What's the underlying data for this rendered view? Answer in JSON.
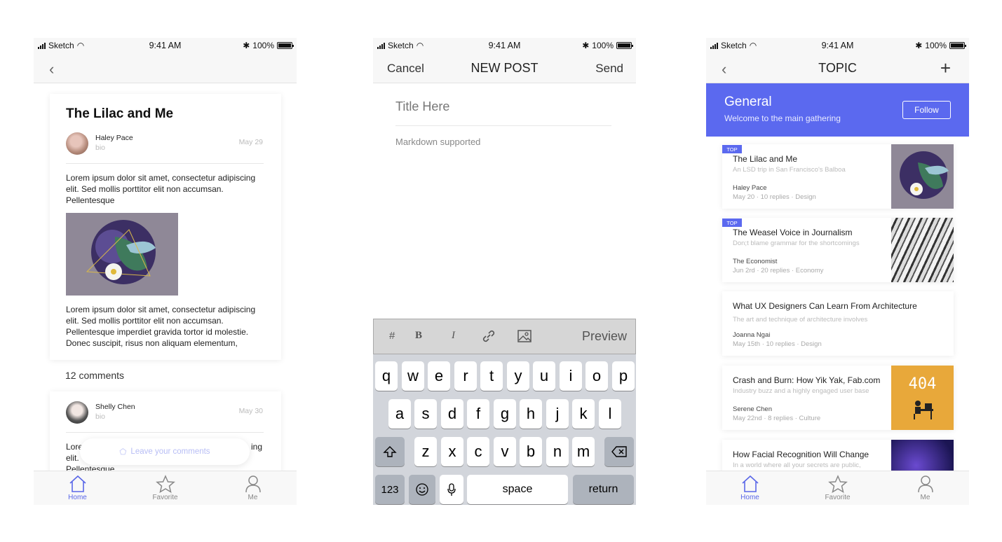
{
  "status": {
    "carrier": "Sketch",
    "time": "9:41 AM",
    "battery": "100%"
  },
  "tabs": [
    {
      "label": "Home",
      "icon": "home-icon"
    },
    {
      "label": "Favorite",
      "icon": "star-icon"
    },
    {
      "label": "Me",
      "icon": "person-icon"
    }
  ],
  "article": {
    "title": "The Lilac and Me",
    "author": "Haley Pace",
    "bio": "bio",
    "date": "May 29",
    "para1": "Lorem ipsum dolor sit amet, consectetur adipiscing elit. Sed mollis porttitor elit non accumsan. Pellentesque",
    "para2": "Lorem ipsum dolor sit amet, consectetur adipiscing elit. Sed mollis porttitor elit non accumsan. Pellentesque imperdiet gravida tortor id molestie. Donec suscipit, risus non aliquam elementum,",
    "comments_count": "12 comments",
    "comment": {
      "author": "Shelly Chen",
      "bio": "bio",
      "date": "May 30",
      "text_start": "Lore",
      "text_line2": "elit.",
      "text_line3": "Pellentesque",
      "text_end": "ing"
    },
    "leave_placeholder": "Leave your comments"
  },
  "new_post": {
    "cancel": "Cancel",
    "title": "NEW POST",
    "send": "Send",
    "title_placeholder": "Title Here",
    "body_placeholder": "Markdown supported",
    "toolbar": {
      "heading": "#",
      "bold": "B",
      "italic": "I",
      "preview": "Preview"
    },
    "keyboard": {
      "row1": [
        "q",
        "w",
        "e",
        "r",
        "t",
        "y",
        "u",
        "i",
        "o",
        "p"
      ],
      "row2": [
        "a",
        "s",
        "d",
        "f",
        "g",
        "h",
        "j",
        "k",
        "l"
      ],
      "row3": [
        "z",
        "x",
        "c",
        "v",
        "b",
        "n",
        "m"
      ],
      "numbers": "123",
      "space": "space",
      "return": "return"
    }
  },
  "topic": {
    "nav_title": "TOPIC",
    "name": "General",
    "subtitle": "Welcome to the main gathering",
    "follow": "Follow",
    "top_badge": "TOP",
    "posts": [
      {
        "title": "The Lilac and Me",
        "sub": "An LSD trip in San Francisco's Balboa",
        "author": "Haley Pace",
        "meta": "May 20 · 10 replies · Design",
        "top": true
      },
      {
        "title": "The Weasel Voice in Journalism",
        "sub": "Don;t blame grammar for the shortcomings",
        "author": "The Economist",
        "meta": "Jun 2rd · 20 replies · Economy",
        "top": true
      },
      {
        "title": "What UX Designers Can Learn From Architecture",
        "sub": "The art and technique of architecture involves",
        "author": "Joanna Ngai",
        "meta": "May 15th · 10 replies · Design",
        "top": false
      },
      {
        "title": "Crash and Burn: How Yik Yak, Fab.com",
        "sub": "Industry buzz and a highly engaged user base",
        "author": "Serene Chen",
        "meta": "May 22nd · 8 replies · Culture",
        "top": false,
        "thumb_text": "404"
      },
      {
        "title": "How Facial Recognition Will Change",
        "sub": "In a world where all your secrets are public,",
        "author": "",
        "meta": "",
        "top": false
      }
    ]
  },
  "colors": {
    "accent": "#5b69ef",
    "article_thumb": "#8f8897",
    "error_thumb": "#e8a83a"
  }
}
